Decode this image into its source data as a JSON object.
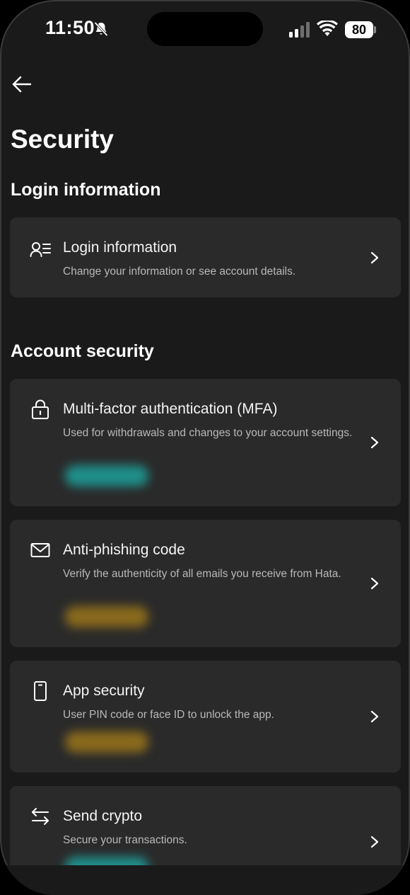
{
  "status_bar": {
    "time": "11:50",
    "battery": "80"
  },
  "page": {
    "title": "Security"
  },
  "sections": {
    "login_heading": "Login information",
    "account_heading": "Account security"
  },
  "cards": {
    "login": {
      "icon": "user-list-icon",
      "title": "Login information",
      "description": "Change your information or see account details."
    },
    "mfa": {
      "icon": "lock-icon",
      "title": "Multi-factor authentication (MFA)",
      "description": "Used for withdrawals and changes to your account settings.",
      "status_color": "#1f8f8a"
    },
    "anti_phishing": {
      "icon": "mail-icon",
      "title": "Anti-phishing code",
      "description": "Verify the authenticity of all emails you receive from Hata.",
      "status_color": "#a07a1e"
    },
    "app_security": {
      "icon": "phone-icon",
      "title": "App security",
      "description": "User PIN code or face ID to unlock the app.",
      "status_color": "#a07a1e"
    },
    "send_crypto": {
      "icon": "swap-arrows-icon",
      "title": "Send crypto",
      "description": "Secure your transactions.",
      "status_color": "#1f8f8a"
    }
  }
}
